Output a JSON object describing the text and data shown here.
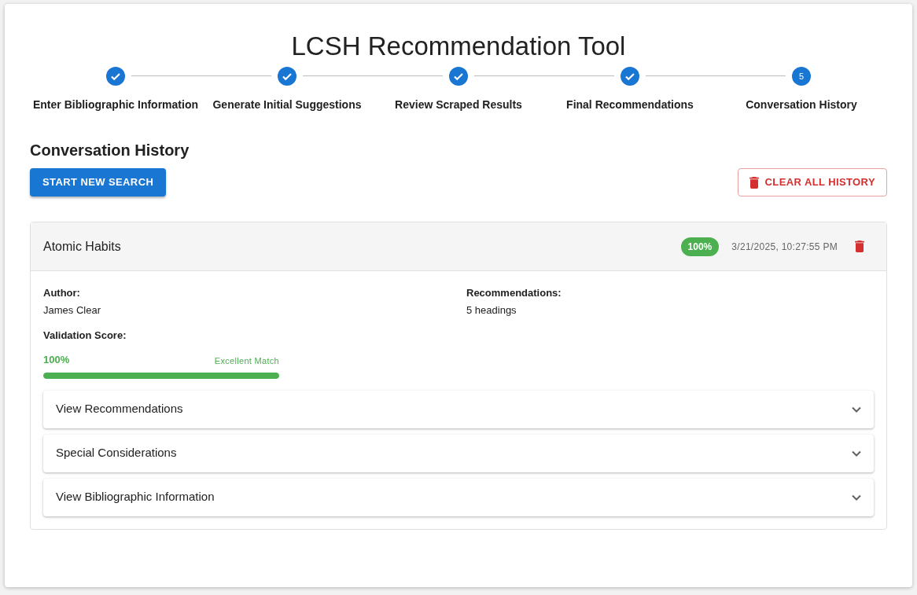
{
  "title": "LCSH Recommendation Tool",
  "steps": [
    {
      "label": "Enter Bibliographic Information",
      "completed": true
    },
    {
      "label": "Generate Initial Suggestions",
      "completed": true
    },
    {
      "label": "Review Scraped Results",
      "completed": true
    },
    {
      "label": "Final Recommendations",
      "completed": true
    },
    {
      "label": "Conversation History",
      "completed": false,
      "number": "5"
    }
  ],
  "section_title": "Conversation History",
  "buttons": {
    "start": "START NEW SEARCH",
    "clear": "CLEAR ALL HISTORY"
  },
  "history": [
    {
      "title": "Atomic Habits",
      "score_badge": "100%",
      "timestamp": "3/21/2025, 10:27:55 PM",
      "fields": [
        {
          "label": "Author:",
          "value": "James Clear"
        },
        {
          "label": "Recommendations:",
          "value": "5 headings"
        }
      ],
      "validation": {
        "label": "Validation Score:",
        "reading": "100%",
        "rating": "Excellent Match",
        "level": 1.0
      },
      "sections": [
        {
          "label": "View Recommendations",
          "expanded": false
        },
        {
          "label": "Special Considerations",
          "expanded": false
        },
        {
          "label": "View Bibliographic Information",
          "expanded": false
        }
      ]
    }
  ]
}
